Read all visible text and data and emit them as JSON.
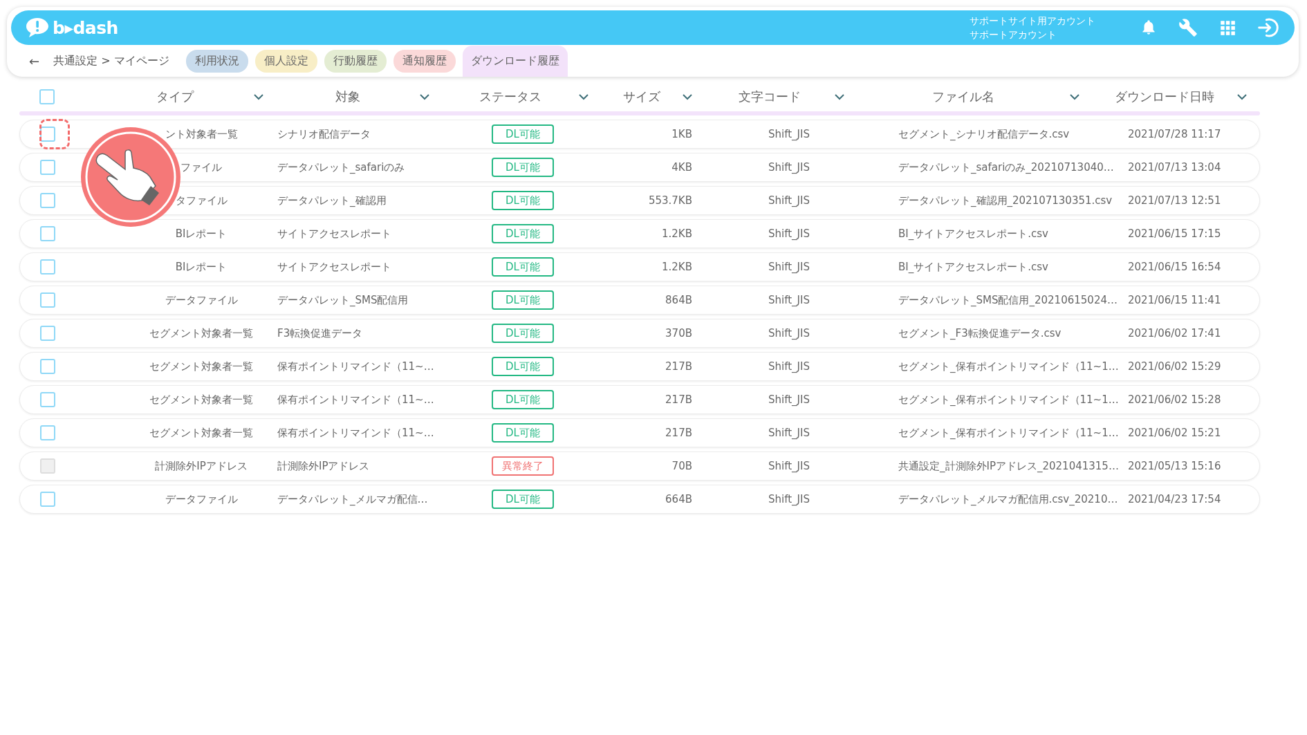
{
  "header": {
    "logo": "b▸dash",
    "account_lines": [
      "サポートサイト用アカウント",
      "サポートアカウント"
    ]
  },
  "nav": {
    "back": "←",
    "breadcrumb": "共通設定 > マイページ",
    "tabs": [
      {
        "label": "利用状況",
        "color": "#c9dced",
        "selected": false
      },
      {
        "label": "個人設定",
        "color": "#f8eec6",
        "selected": false
      },
      {
        "label": "行動履歴",
        "color": "#e4edd3",
        "selected": false
      },
      {
        "label": "通知履歴",
        "color": "#fbd9d9",
        "selected": false
      },
      {
        "label": "ダウンロード履歴",
        "color": "#f3e2fa",
        "selected": true
      }
    ]
  },
  "table": {
    "select_all": {
      "checked": false
    },
    "columns": [
      "タイプ",
      "対象",
      "ステータス",
      "サイズ",
      "文字コード",
      "ファイル名",
      "ダウンロード日時"
    ],
    "rows": [
      {
        "checked": false,
        "disabled": false,
        "highlighted": true,
        "type": "ント対象者一覧",
        "target": "シナリオ配信データ",
        "status": {
          "label": "DL可能",
          "kind": "ok"
        },
        "size": "1KB",
        "encoding": "Shift_JIS",
        "file_name": "セグメント_シナリオ配信データ.csv",
        "downloaded_at": "2021/07/28 11:17"
      },
      {
        "checked": false,
        "disabled": false,
        "highlighted": false,
        "type": "ファイル",
        "target": "データパレット_safariのみ",
        "status": {
          "label": "DL可能",
          "kind": "ok"
        },
        "size": "4KB",
        "encoding": "Shift_JIS",
        "file_name": "データパレット_safariのみ_20210713040…",
        "downloaded_at": "2021/07/13 13:04"
      },
      {
        "checked": false,
        "disabled": false,
        "highlighted": false,
        "type": "タファイル",
        "target": "データパレット_確認用",
        "status": {
          "label": "DL可能",
          "kind": "ok"
        },
        "size": "553.7KB",
        "encoding": "Shift_JIS",
        "file_name": "データパレット_確認用_202107130351.csv",
        "downloaded_at": "2021/07/13 12:51"
      },
      {
        "checked": false,
        "disabled": false,
        "highlighted": false,
        "type": "BIレポート",
        "target": "サイトアクセスレポート",
        "status": {
          "label": "DL可能",
          "kind": "ok"
        },
        "size": "1.2KB",
        "encoding": "Shift_JIS",
        "file_name": "BI_サイトアクセスレポート.csv",
        "downloaded_at": "2021/06/15 17:15"
      },
      {
        "checked": false,
        "disabled": false,
        "highlighted": false,
        "type": "BIレポート",
        "target": "サイトアクセスレポート",
        "status": {
          "label": "DL可能",
          "kind": "ok"
        },
        "size": "1.2KB",
        "encoding": "Shift_JIS",
        "file_name": "BI_サイトアクセスレポート.csv",
        "downloaded_at": "2021/06/15 16:54"
      },
      {
        "checked": false,
        "disabled": false,
        "highlighted": false,
        "type": "データファイル",
        "target": "データパレット_SMS配信用",
        "status": {
          "label": "DL可能",
          "kind": "ok"
        },
        "size": "864B",
        "encoding": "Shift_JIS",
        "file_name": "データパレット_SMS配信用_20210615024…",
        "downloaded_at": "2021/06/15 11:41"
      },
      {
        "checked": false,
        "disabled": false,
        "highlighted": false,
        "type": "セグメント対象者一覧",
        "target": "F3転換促進データ",
        "status": {
          "label": "DL可能",
          "kind": "ok"
        },
        "size": "370B",
        "encoding": "Shift_JIS",
        "file_name": "セグメント_F3転換促進データ.csv",
        "downloaded_at": "2021/06/02 17:41"
      },
      {
        "checked": false,
        "disabled": false,
        "highlighted": false,
        "type": "セグメント対象者一覧",
        "target": "保有ポイントリマインド（11~…",
        "status": {
          "label": "DL可能",
          "kind": "ok"
        },
        "size": "217B",
        "encoding": "Shift_JIS",
        "file_name": "セグメント_保有ポイントリマインド（11~1…",
        "downloaded_at": "2021/06/02 15:29"
      },
      {
        "checked": false,
        "disabled": false,
        "highlighted": false,
        "type": "セグメント対象者一覧",
        "target": "保有ポイントリマインド（11~…",
        "status": {
          "label": "DL可能",
          "kind": "ok"
        },
        "size": "217B",
        "encoding": "Shift_JIS",
        "file_name": "セグメント_保有ポイントリマインド（11~1…",
        "downloaded_at": "2021/06/02 15:28"
      },
      {
        "checked": false,
        "disabled": false,
        "highlighted": false,
        "type": "セグメント対象者一覧",
        "target": "保有ポイントリマインド（11~…",
        "status": {
          "label": "DL可能",
          "kind": "ok"
        },
        "size": "217B",
        "encoding": "Shift_JIS",
        "file_name": "セグメント_保有ポイントリマインド（11~1…",
        "downloaded_at": "2021/06/02 15:21"
      },
      {
        "checked": false,
        "disabled": true,
        "highlighted": false,
        "type": "計測除外IPアドレス",
        "target": "計測除外IPアドレス",
        "status": {
          "label": "異常終了",
          "kind": "error"
        },
        "size": "70B",
        "encoding": "Shift_JIS",
        "file_name": "共通設定_計測除外IPアドレス_2021041315…",
        "downloaded_at": "2021/05/13 15:16"
      },
      {
        "checked": false,
        "disabled": false,
        "highlighted": false,
        "type": "データファイル",
        "target": "データパレット_メルマガ配信…",
        "status": {
          "label": "DL可能",
          "kind": "ok"
        },
        "size": "664B",
        "encoding": "Shift_JIS",
        "file_name": "データパレット_メルマガ配信用.csv_20210…",
        "downloaded_at": "2021/04/23 17:54"
      }
    ]
  }
}
